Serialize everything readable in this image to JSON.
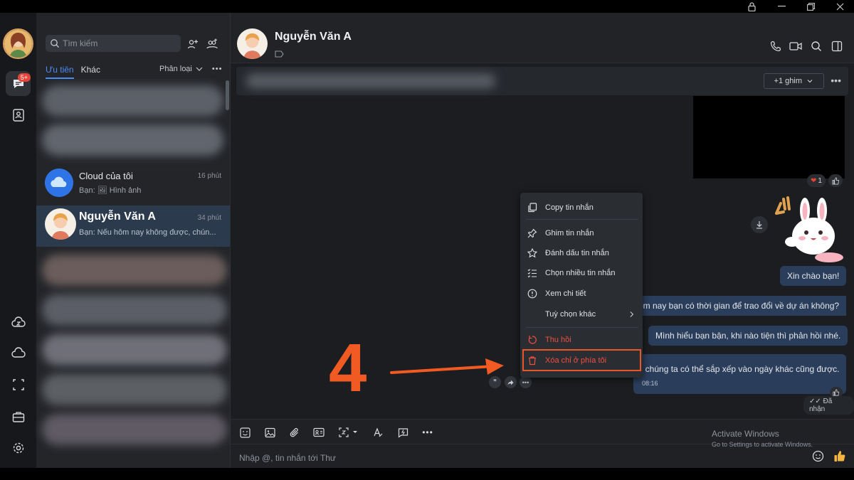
{
  "window": {
    "controls": [
      "lock",
      "minimize",
      "restore",
      "close"
    ]
  },
  "rail": {
    "messages_badge": "5+",
    "icons": [
      "chat-icon",
      "contacts-icon",
      "zcloud-icon",
      "cloud-icon",
      "screenshot-icon",
      "briefcase-icon",
      "settings-icon"
    ]
  },
  "sidebar": {
    "search_placeholder": "Tìm kiếm",
    "tabs": [
      {
        "label": "Ưu tiên",
        "active": true
      },
      {
        "label": "Khác",
        "active": false
      }
    ],
    "filter_label": "Phân loại",
    "conversations": [
      {
        "name": "Cloud của tôi",
        "time": "16 phút",
        "preview": "Bạn: 🖼 Hình ảnh"
      },
      {
        "name": "Nguyễn Văn A",
        "time": "34 phút",
        "preview": "Bạn: Nếu hôm nay không được, chún..."
      }
    ]
  },
  "chat": {
    "name": "Nguyễn Văn A",
    "pin_button": "+1 ghim",
    "reaction_count": "1",
    "messages": [
      "Xin chào bạn!",
      "ôm nay bạn có thời gian để trao đổi về dự án không?",
      "Mình hiểu bạn bận, khi nào tiện thì phản hồi nhé.",
      ", chúng ta có thể sắp xếp vào ngày khác cũng được."
    ],
    "message_time": "08:16",
    "seen_label": "Đã nhận",
    "composer_placeholder": "Nhập @, tin nhắn tới Thư"
  },
  "context_menu": {
    "items": [
      "Copy tin nhắn",
      "Ghim tin nhắn",
      "Đánh dấu tin nhắn",
      "Chọn nhiều tin nhắn",
      "Xem chi tiết",
      "Tuỳ chọn khác",
      "Thu hồi",
      "Xóa chỉ ở phía tôi"
    ]
  },
  "annotation": {
    "step_number": "4"
  },
  "watermark": {
    "title": "Activate Windows",
    "subtitle": "Go to Settings to activate Windows."
  },
  "colors": {
    "accent": "#4b8cf5",
    "danger": "#f04f43",
    "annotation": "#f15a22"
  }
}
